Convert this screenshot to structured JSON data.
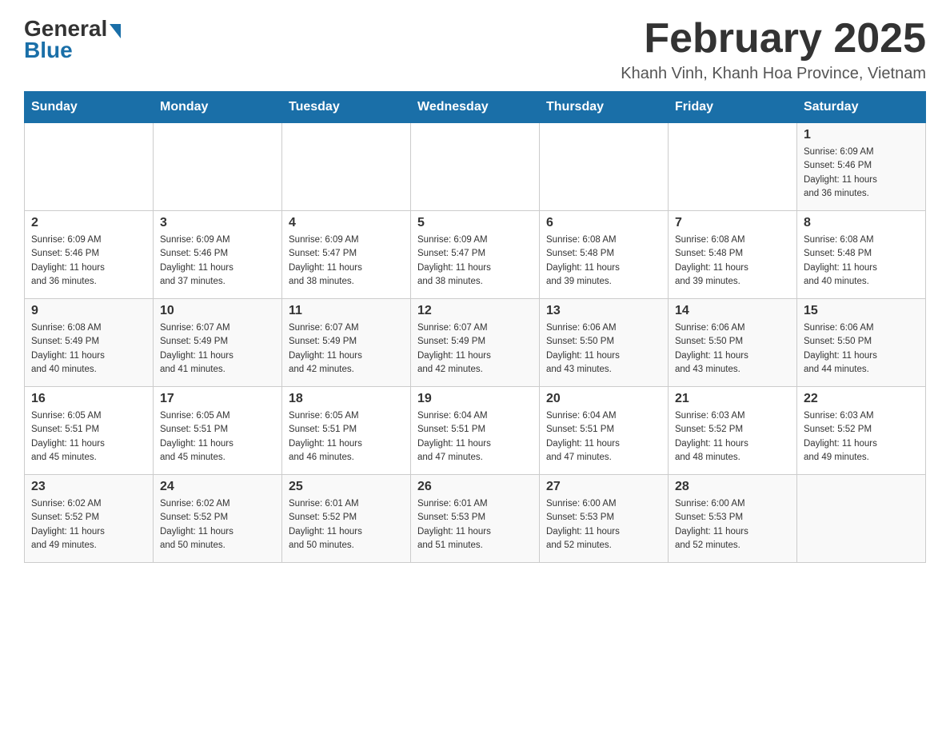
{
  "header": {
    "logo_general": "General",
    "logo_blue": "Blue",
    "month_title": "February 2025",
    "location": "Khanh Vinh, Khanh Hoa Province, Vietnam"
  },
  "days_of_week": [
    "Sunday",
    "Monday",
    "Tuesday",
    "Wednesday",
    "Thursday",
    "Friday",
    "Saturday"
  ],
  "weeks": [
    {
      "days": [
        {
          "date": "",
          "info": ""
        },
        {
          "date": "",
          "info": ""
        },
        {
          "date": "",
          "info": ""
        },
        {
          "date": "",
          "info": ""
        },
        {
          "date": "",
          "info": ""
        },
        {
          "date": "",
          "info": ""
        },
        {
          "date": "1",
          "info": "Sunrise: 6:09 AM\nSunset: 5:46 PM\nDaylight: 11 hours\nand 36 minutes."
        }
      ]
    },
    {
      "days": [
        {
          "date": "2",
          "info": "Sunrise: 6:09 AM\nSunset: 5:46 PM\nDaylight: 11 hours\nand 36 minutes."
        },
        {
          "date": "3",
          "info": "Sunrise: 6:09 AM\nSunset: 5:46 PM\nDaylight: 11 hours\nand 37 minutes."
        },
        {
          "date": "4",
          "info": "Sunrise: 6:09 AM\nSunset: 5:47 PM\nDaylight: 11 hours\nand 38 minutes."
        },
        {
          "date": "5",
          "info": "Sunrise: 6:09 AM\nSunset: 5:47 PM\nDaylight: 11 hours\nand 38 minutes."
        },
        {
          "date": "6",
          "info": "Sunrise: 6:08 AM\nSunset: 5:48 PM\nDaylight: 11 hours\nand 39 minutes."
        },
        {
          "date": "7",
          "info": "Sunrise: 6:08 AM\nSunset: 5:48 PM\nDaylight: 11 hours\nand 39 minutes."
        },
        {
          "date": "8",
          "info": "Sunrise: 6:08 AM\nSunset: 5:48 PM\nDaylight: 11 hours\nand 40 minutes."
        }
      ]
    },
    {
      "days": [
        {
          "date": "9",
          "info": "Sunrise: 6:08 AM\nSunset: 5:49 PM\nDaylight: 11 hours\nand 40 minutes."
        },
        {
          "date": "10",
          "info": "Sunrise: 6:07 AM\nSunset: 5:49 PM\nDaylight: 11 hours\nand 41 minutes."
        },
        {
          "date": "11",
          "info": "Sunrise: 6:07 AM\nSunset: 5:49 PM\nDaylight: 11 hours\nand 42 minutes."
        },
        {
          "date": "12",
          "info": "Sunrise: 6:07 AM\nSunset: 5:49 PM\nDaylight: 11 hours\nand 42 minutes."
        },
        {
          "date": "13",
          "info": "Sunrise: 6:06 AM\nSunset: 5:50 PM\nDaylight: 11 hours\nand 43 minutes."
        },
        {
          "date": "14",
          "info": "Sunrise: 6:06 AM\nSunset: 5:50 PM\nDaylight: 11 hours\nand 43 minutes."
        },
        {
          "date": "15",
          "info": "Sunrise: 6:06 AM\nSunset: 5:50 PM\nDaylight: 11 hours\nand 44 minutes."
        }
      ]
    },
    {
      "days": [
        {
          "date": "16",
          "info": "Sunrise: 6:05 AM\nSunset: 5:51 PM\nDaylight: 11 hours\nand 45 minutes."
        },
        {
          "date": "17",
          "info": "Sunrise: 6:05 AM\nSunset: 5:51 PM\nDaylight: 11 hours\nand 45 minutes."
        },
        {
          "date": "18",
          "info": "Sunrise: 6:05 AM\nSunset: 5:51 PM\nDaylight: 11 hours\nand 46 minutes."
        },
        {
          "date": "19",
          "info": "Sunrise: 6:04 AM\nSunset: 5:51 PM\nDaylight: 11 hours\nand 47 minutes."
        },
        {
          "date": "20",
          "info": "Sunrise: 6:04 AM\nSunset: 5:51 PM\nDaylight: 11 hours\nand 47 minutes."
        },
        {
          "date": "21",
          "info": "Sunrise: 6:03 AM\nSunset: 5:52 PM\nDaylight: 11 hours\nand 48 minutes."
        },
        {
          "date": "22",
          "info": "Sunrise: 6:03 AM\nSunset: 5:52 PM\nDaylight: 11 hours\nand 49 minutes."
        }
      ]
    },
    {
      "days": [
        {
          "date": "23",
          "info": "Sunrise: 6:02 AM\nSunset: 5:52 PM\nDaylight: 11 hours\nand 49 minutes."
        },
        {
          "date": "24",
          "info": "Sunrise: 6:02 AM\nSunset: 5:52 PM\nDaylight: 11 hours\nand 50 minutes."
        },
        {
          "date": "25",
          "info": "Sunrise: 6:01 AM\nSunset: 5:52 PM\nDaylight: 11 hours\nand 50 minutes."
        },
        {
          "date": "26",
          "info": "Sunrise: 6:01 AM\nSunset: 5:53 PM\nDaylight: 11 hours\nand 51 minutes."
        },
        {
          "date": "27",
          "info": "Sunrise: 6:00 AM\nSunset: 5:53 PM\nDaylight: 11 hours\nand 52 minutes."
        },
        {
          "date": "28",
          "info": "Sunrise: 6:00 AM\nSunset: 5:53 PM\nDaylight: 11 hours\nand 52 minutes."
        },
        {
          "date": "",
          "info": ""
        }
      ]
    }
  ]
}
